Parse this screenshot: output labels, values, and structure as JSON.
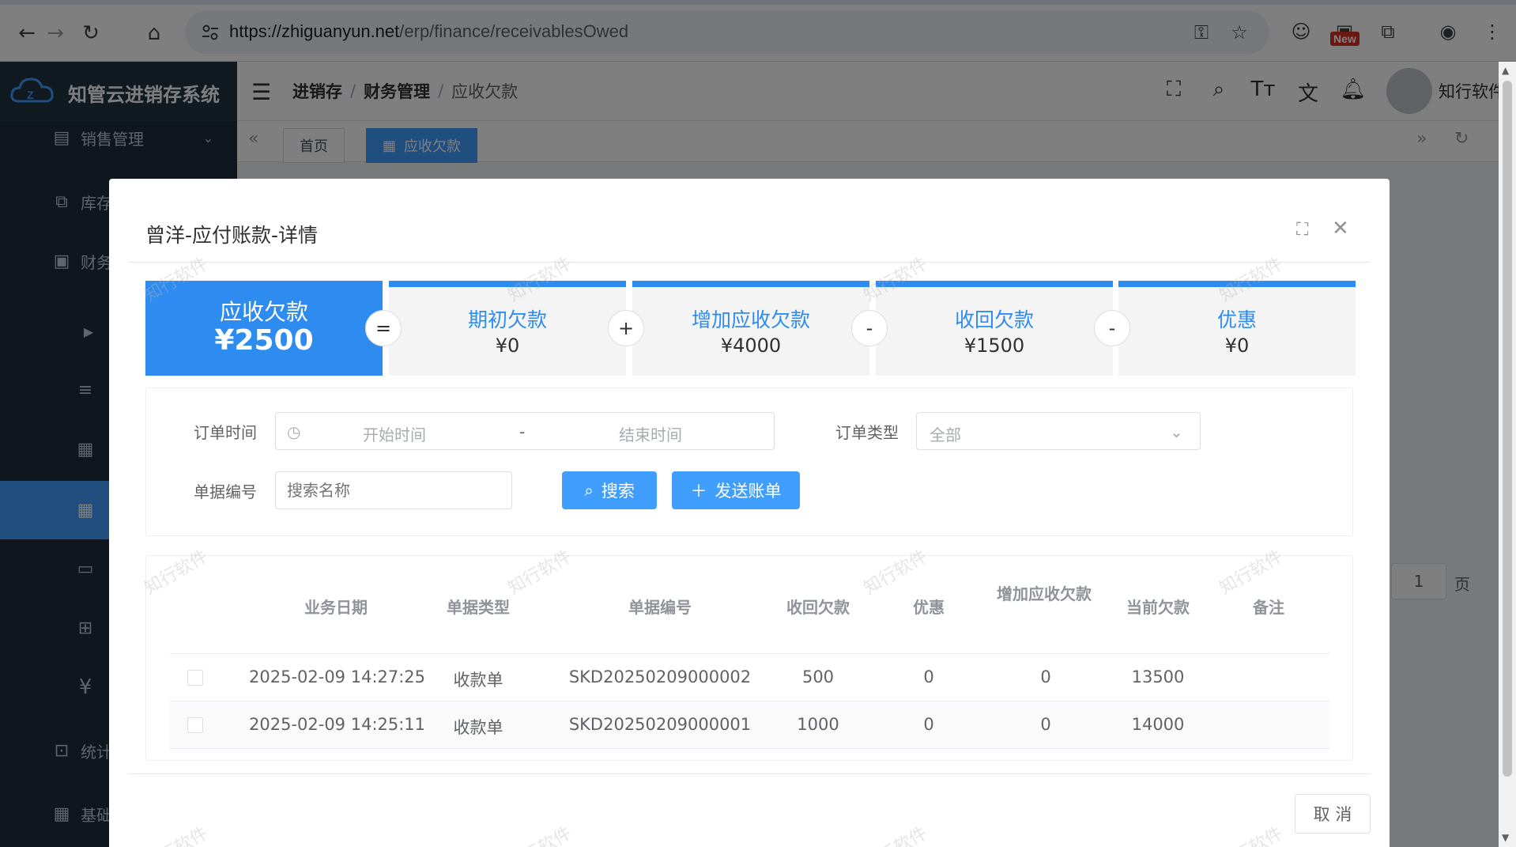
{
  "browser": {
    "url_host": "https://zhiguanyun.net",
    "url_path": "/erp/finance/receivablesOwed",
    "new_badge": "New"
  },
  "app": {
    "logo_title": "知管云进销存系统",
    "sidebar": {
      "items": [
        {
          "label": "销售管理",
          "icon": "document-icon"
        },
        {
          "label": "库存",
          "icon": "stack-icon"
        },
        {
          "label": "财务",
          "icon": "finance-icon"
        },
        {
          "label": "",
          "icon": "caret-right-icon"
        },
        {
          "label": "",
          "icon": "list-icon"
        },
        {
          "label": "",
          "icon": "calendar-icon"
        },
        {
          "label": "",
          "icon": "calendar-icon",
          "active": true
        },
        {
          "label": "",
          "icon": "folder-icon"
        },
        {
          "label": "",
          "icon": "folder-add-icon"
        },
        {
          "label": "",
          "icon": "yen-icon"
        },
        {
          "label": "统计",
          "icon": "chart-icon"
        },
        {
          "label": "基础",
          "icon": "grid-icon"
        }
      ]
    },
    "breadcrumb": [
      "进销存",
      "财务管理",
      "应收欠款"
    ],
    "user_name": "知行软件",
    "tags": [
      "首页",
      "应收欠款"
    ]
  },
  "dialog": {
    "title": "曾洋-应付账款-详情",
    "summary": {
      "main": {
        "label": "应收欠款",
        "value": "¥2500"
      },
      "ops": [
        "=",
        "+",
        "-",
        "-"
      ],
      "cards": [
        {
          "label": "期初欠款",
          "value": "¥0"
        },
        {
          "label": "增加应收欠款",
          "value": "¥4000"
        },
        {
          "label": "收回欠款",
          "value": "¥1500"
        },
        {
          "label": "优惠",
          "value": "¥0"
        }
      ]
    },
    "filter": {
      "order_time_label": "订单时间",
      "start_placeholder": "开始时间",
      "range_sep": "-",
      "end_placeholder": "结束时间",
      "order_type_label": "订单类型",
      "order_type_value": "全部",
      "doc_no_label": "单据编号",
      "doc_no_placeholder": "搜索名称",
      "search_btn": "搜索",
      "send_btn": "发送账单"
    },
    "table": {
      "headers": [
        "业务日期",
        "单据类型",
        "单据编号",
        "收回欠款",
        "优惠",
        "增加应收欠款",
        "当前欠款",
        "备注"
      ],
      "rows": [
        [
          "2025-02-09 14:27:25",
          "收款单",
          "SKD20250209000002",
          "500",
          "0",
          "0",
          "13500",
          ""
        ],
        [
          "2025-02-09 14:25:11",
          "收款单",
          "SKD20250209000001",
          "1000",
          "0",
          "0",
          "14000",
          ""
        ]
      ]
    },
    "cancel_btn": "取 消",
    "watermark": "知行软件"
  },
  "background_page": {
    "page_input": "1",
    "page_unit": "页"
  },
  "colors": {
    "accent": "#409eff",
    "summary_blue": "#2e8cf0",
    "sidebar_bg": "#1f2d3d"
  }
}
